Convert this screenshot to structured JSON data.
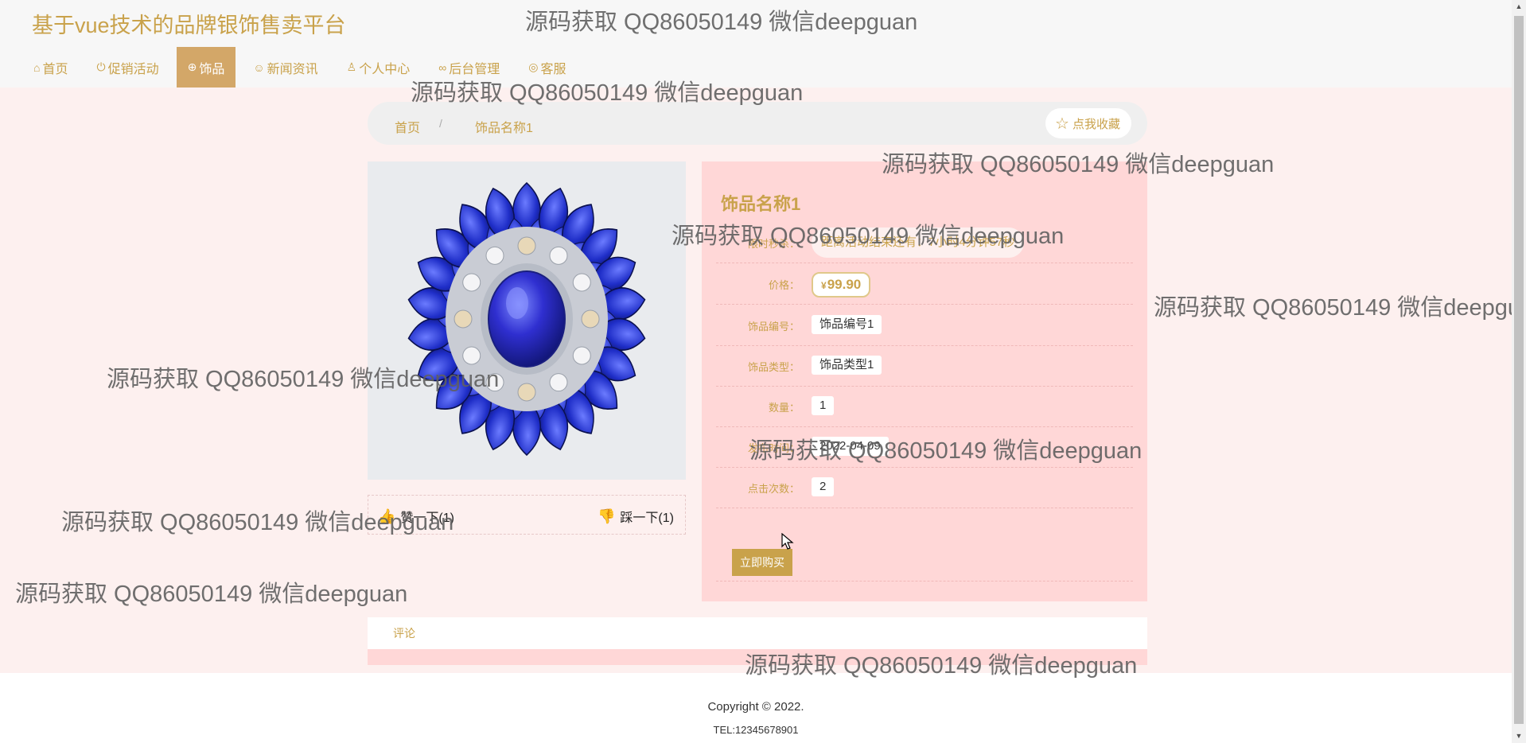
{
  "header": {
    "site_title": "基于vue技术的品牌银饰售卖平台",
    "nav": [
      {
        "label": "首页",
        "icon": "home-icon",
        "glyph": "⌂"
      },
      {
        "label": "促销活动",
        "icon": "power-icon",
        "glyph": "⏻"
      },
      {
        "label": "饰品",
        "icon": "globe-icon",
        "glyph": "⊕",
        "active": true
      },
      {
        "label": "新闻资讯",
        "icon": "smile-icon",
        "glyph": "☺"
      },
      {
        "label": "个人中心",
        "icon": "user-icon",
        "glyph": "♙"
      },
      {
        "label": "后台管理",
        "icon": "link-icon",
        "glyph": "∞"
      },
      {
        "label": "客服",
        "icon": "support-icon",
        "glyph": "◎"
      }
    ]
  },
  "breadcrumb": {
    "home": "首页",
    "separator": "/",
    "current": "饰品名称1",
    "favorite_label": "点我收藏"
  },
  "product": {
    "name": "饰品名称1",
    "image_alt": "blue crystal brooch",
    "rows": {
      "countdown": {
        "label": "限时秒杀：",
        "value": "距离活动结束还有：7小时4分钟57秒"
      },
      "price": {
        "label": "价格：",
        "currency": "¥",
        "value": "99.90"
      },
      "code": {
        "label": "饰品编号：",
        "value": "饰品编号1"
      },
      "type": {
        "label": "饰品类型：",
        "value": "饰品类型1"
      },
      "quantity": {
        "label": "数量：",
        "value": "1"
      },
      "publish_time": {
        "label": "发布时间：",
        "value": "2022-04-09"
      },
      "clicks": {
        "label": "点击次数：",
        "value": "2"
      }
    },
    "buy_label": "立即购买",
    "like_label": "赞一下(1)",
    "dislike_label": "踩一下(1)"
  },
  "comments": {
    "tab_label": "评论"
  },
  "footer": {
    "copyright": "Copyright © 2022.",
    "tel": "TEL:12345678901"
  },
  "watermark": "源码获取 QQ86050149 微信deepguan",
  "colors": {
    "accent": "#c9a24b",
    "nav_active": "#d3a768",
    "panel_bg": "#ffd7d7",
    "page_bg": "#fdf0ef",
    "vote_icon": "#e0302d"
  }
}
